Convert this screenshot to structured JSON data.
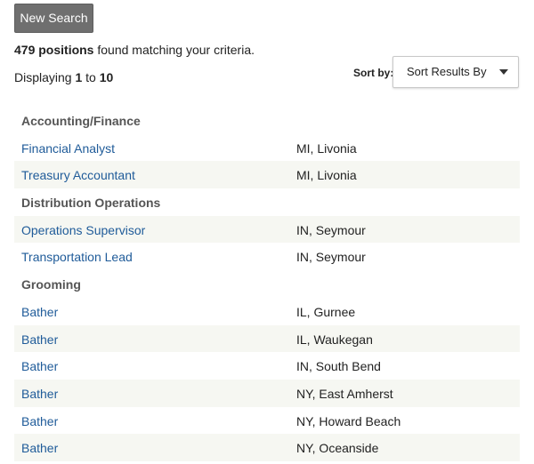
{
  "toolbar": {
    "new_search_label": "New Search"
  },
  "summary": {
    "count": "479 positions",
    "rest": " found matching your criteria."
  },
  "paging": {
    "prefix": "Displaying ",
    "start": "1",
    "mid": " to ",
    "end": "10"
  },
  "sort": {
    "label": "Sort by:",
    "selected": "Sort Results By"
  },
  "results": {
    "categories": [
      "Accounting/Finance",
      "Distribution Operations",
      "Grooming"
    ],
    "jobs": [
      {
        "title": "Financial Analyst",
        "location": "MI, Livonia"
      },
      {
        "title": "Treasury Accountant",
        "location": "MI, Livonia"
      },
      {
        "title": "Operations Supervisor",
        "location": "IN, Seymour"
      },
      {
        "title": "Transportation Lead",
        "location": "IN, Seymour"
      },
      {
        "title": "Bather",
        "location": "IL, Gurnee"
      },
      {
        "title": "Bather",
        "location": "IL, Waukegan"
      },
      {
        "title": "Bather",
        "location": "IN, South Bend"
      },
      {
        "title": "Bather",
        "location": "NY, East Amherst"
      },
      {
        "title": "Bather",
        "location": "NY, Howard Beach"
      },
      {
        "title": "Bather",
        "location": "NY, Oceanside"
      }
    ]
  }
}
